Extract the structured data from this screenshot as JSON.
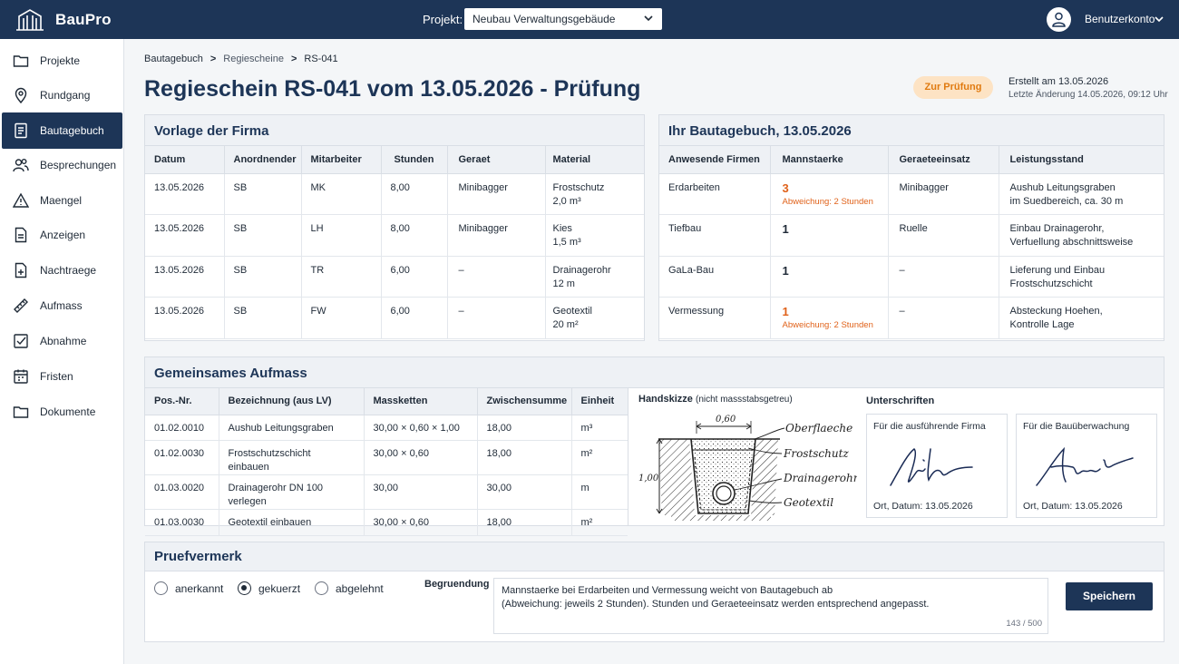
{
  "app": {
    "brand": "BauPro"
  },
  "header": {
    "project_label": "Projekt:",
    "project_value": "Neubau Verwaltungsgebäude",
    "account_label": "Benutzerkonto"
  },
  "sidebar": {
    "items": [
      {
        "label": "Projekte",
        "icon": "folder-icon"
      },
      {
        "label": "Rundgang",
        "icon": "location-pin-icon"
      },
      {
        "label": "Bautagebuch",
        "icon": "document-icon",
        "active": true
      },
      {
        "label": "Besprechungen",
        "icon": "people-icon"
      },
      {
        "label": "Maengel",
        "icon": "warning-icon"
      },
      {
        "label": "Anzeigen",
        "icon": "file-icon"
      },
      {
        "label": "Nachtraege",
        "icon": "file-plus-icon"
      },
      {
        "label": "Aufmass",
        "icon": "ruler-icon"
      },
      {
        "label": "Abnahme",
        "icon": "checkbox-icon"
      },
      {
        "label": "Fristen",
        "icon": "calendar-icon"
      },
      {
        "label": "Dokumente",
        "icon": "folder-icon"
      }
    ]
  },
  "breadcrumb": {
    "items": [
      "Bautagebuch",
      "Regiescheine",
      "RS-041"
    ],
    "separator": ">"
  },
  "page": {
    "title": "Regieschein RS-041 vom 13.05.2026 - Prüfung",
    "status": "Zur Prüfung",
    "created": "Erstellt am 13.05.2026",
    "modified": "Letzte Änderung 14.05.2026, 09:12 Uhr"
  },
  "vorlage": {
    "title": "Vorlage der Firma",
    "columns": [
      "Datum",
      "Anordnender",
      "Mitarbeiter",
      "Stunden",
      "Geraet",
      "Material"
    ],
    "rows": [
      {
        "datum": "13.05.2026",
        "anordnender": "SB",
        "mitarbeiter": "MK",
        "stunden": "8,00",
        "geraet": "Minibagger",
        "material1": "Frostschutz",
        "material2": "2,0 m³"
      },
      {
        "datum": "13.05.2026",
        "anordnender": "SB",
        "mitarbeiter": "LH",
        "stunden": "8,00",
        "geraet": "Minibagger",
        "material1": "Kies",
        "material2": "1,5 m³"
      },
      {
        "datum": "13.05.2026",
        "anordnender": "SB",
        "mitarbeiter": "TR",
        "stunden": "6,00",
        "geraet": "–",
        "material1": "Drainagerohr",
        "material2": "12 m"
      },
      {
        "datum": "13.05.2026",
        "anordnender": "SB",
        "mitarbeiter": "FW",
        "stunden": "6,00",
        "geraet": "–",
        "material1": "Geotextil",
        "material2": "20 m²"
      }
    ]
  },
  "bautagebuch": {
    "title": "Ihr Bautagebuch, 13.05.2026",
    "columns": [
      "Anwesende Firmen",
      "Mannstaerke",
      "Geraeteeinsatz",
      "Leistungsstand"
    ],
    "rows": [
      {
        "firma": "Erdarbeiten",
        "mann": "3",
        "abweichung": "Abweichung: 2 Stunden",
        "geraet": "Minibagger",
        "leistung1": "Aushub Leitungsgraben",
        "leistung2": "im Suedbereich, ca. 30 m"
      },
      {
        "firma": "Tiefbau",
        "mann": "1",
        "abweichung": "",
        "geraet": "Ruelle",
        "leistung1": "Einbau Drainagerohr,",
        "leistung2": "Verfuellung abschnittsweise"
      },
      {
        "firma": "GaLa-Bau",
        "mann": "1",
        "abweichung": "",
        "geraet": "–",
        "leistung1": "Lieferung und Einbau",
        "leistung2": "Frostschutzschicht"
      },
      {
        "firma": "Vermessung",
        "mann": "1",
        "abweichung": "Abweichung: 2 Stunden",
        "geraet": "–",
        "leistung1": "Absteckung Hoehen,",
        "leistung2": "Kontrolle Lage"
      }
    ]
  },
  "aufmass": {
    "title": "Gemeinsames Aufmass",
    "columns": [
      "Pos.-Nr.",
      "Bezeichnung (aus LV)",
      "Massketten",
      "Zwischensumme",
      "Einheit"
    ],
    "rows": [
      {
        "pos": "01.02.0010",
        "bez": "Aushub Leitungsgraben",
        "mass": "30,00 × 0,60 × 1,00",
        "summe": "18,00",
        "einheit": "m³"
      },
      {
        "pos": "01.02.0030",
        "bez": "Frostschutzschicht einbauen",
        "mass": "30,00 × 0,60",
        "summe": "18,00",
        "einheit": "m²"
      },
      {
        "pos": "01.03.0020",
        "bez": "Drainagerohr DN 100 verlegen",
        "mass": "30,00",
        "summe": "30,00",
        "einheit": "m"
      },
      {
        "pos": "01.03.0030",
        "bez": "Geotextil einbauen",
        "mass": "30,00 × 0,60",
        "summe": "18,00",
        "einheit": "m²"
      }
    ],
    "sketch": {
      "title": "Handskizze",
      "note": "(nicht massstabsgetreu)",
      "width": "0,60",
      "depth": "1,00",
      "labels": [
        "Oberflaeche",
        "Frostschutz",
        "Drainagerohr",
        "Geotextil"
      ]
    },
    "signatures": {
      "title": "Unterschriften",
      "firma_label": "Für die ausführende Firma",
      "firma_date": "Ort, Datum: 13.05.2026",
      "bau_label": "Für die Bauüberwachung",
      "bau_date": "Ort, Datum: 13.05.2026"
    }
  },
  "pruef": {
    "title": "Pruefvermerk",
    "options": [
      "anerkannt",
      "gekuerzt",
      "abgelehnt"
    ],
    "selected": "gekuerzt",
    "reason_label": "Begruendung",
    "reason_line1": "Mannstaerke bei Erdarbeiten und Vermessung weicht von Bautagebuch ab",
    "reason_line2": "(Abweichung: jeweils 2 Stunden). Stunden und Geraeteeinsatz werden entsprechend angepasst.",
    "counter": "143 / 500",
    "save_label": "Speichern"
  },
  "colors": {
    "primary": "#1d3557",
    "warning": "#e0621a",
    "badge_bg": "#fde3c4"
  }
}
